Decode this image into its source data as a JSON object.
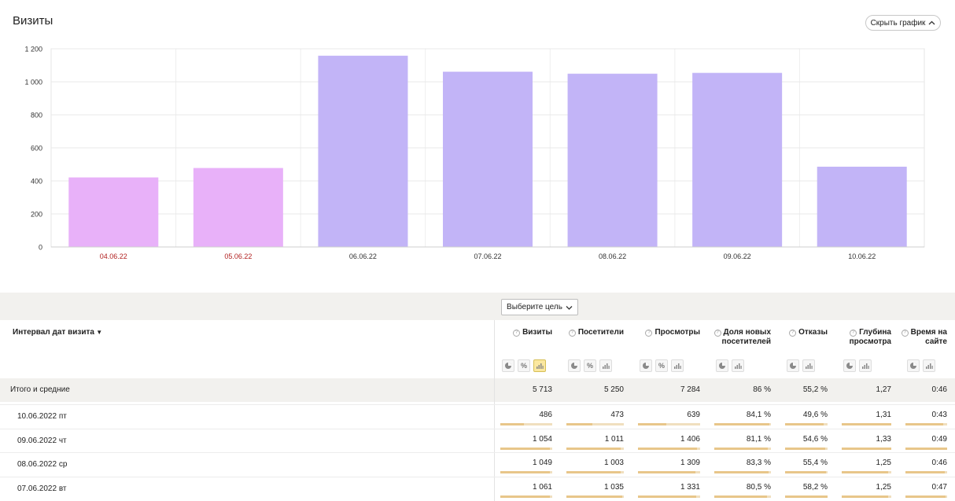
{
  "title": "Визиты",
  "hide_chart_label": "Скрыть график",
  "goal_select_label": "Выберите цель",
  "chart_data": {
    "type": "bar",
    "categories": [
      "04.06.22",
      "05.06.22",
      "06.06.22",
      "07.06.22",
      "08.06.22",
      "09.06.22",
      "10.06.22"
    ],
    "values": [
      421,
      478,
      1158,
      1061,
      1049,
      1054,
      486
    ],
    "weekend": [
      true,
      true,
      false,
      false,
      false,
      false,
      false
    ],
    "yticks": [
      "0",
      "200",
      "400",
      "600",
      "800",
      "1 000",
      "1 200"
    ],
    "ylim": [
      0,
      1200
    ],
    "colors": {
      "weekday": "#c2b4f7",
      "weekend": "#e8b1f9",
      "weekend_label": "#b22222"
    },
    "grid": true
  },
  "table": {
    "dim_header": "Интервал дат визита",
    "columns": [
      {
        "name": "visits",
        "label": "Визиты",
        "icons": [
          "pie",
          "percent",
          "bars"
        ],
        "active": "bars"
      },
      {
        "name": "visitors",
        "label": "Посетители",
        "icons": [
          "pie",
          "percent",
          "bars"
        ]
      },
      {
        "name": "pageviews",
        "label": "Просмотры",
        "icons": [
          "pie",
          "percent",
          "bars"
        ]
      },
      {
        "name": "new-visitors-share",
        "label": "Доля новых посетителей",
        "icons": [
          "pie",
          "bars"
        ]
      },
      {
        "name": "bounces",
        "label": "Отказы",
        "icons": [
          "pie",
          "bars"
        ]
      },
      {
        "name": "depth",
        "label": "Глубина просмотра",
        "icons": [
          "pie",
          "bars"
        ]
      },
      {
        "name": "time-on-site",
        "label": "Время на сайте",
        "icons": [
          "pie",
          "bars"
        ]
      }
    ],
    "total": {
      "label": "Итого и средние",
      "values": [
        "5 713",
        "5 250",
        "7 284",
        "86 %",
        "55,2 %",
        "1,27",
        "0:46"
      ]
    },
    "rows": [
      {
        "label": "10.06.2022 пт",
        "values": [
          "486",
          "473",
          "639",
          "84,1 %",
          "49,6 %",
          "1,31",
          "0:43"
        ],
        "fill": [
          0.45,
          0.45,
          0.45,
          0.97,
          0.9,
          1.0,
          0.9
        ]
      },
      {
        "label": "09.06.2022 чт",
        "values": [
          "1 054",
          "1 011",
          "1 406",
          "81,1 %",
          "54,6 %",
          "1,33",
          "0:49"
        ],
        "fill": [
          0.95,
          0.95,
          0.95,
          0.94,
          0.95,
          1.0,
          1.0
        ]
      },
      {
        "label": "08.06.2022 ср",
        "values": [
          "1 049",
          "1 003",
          "1 309",
          "83,3 %",
          "55,4 %",
          "1,25",
          "0:46"
        ],
        "fill": [
          0.95,
          0.95,
          0.93,
          0.96,
          0.96,
          0.94,
          0.94
        ]
      },
      {
        "label": "07.06.2022 вт",
        "values": [
          "1 061",
          "1 035",
          "1 331",
          "80,5 %",
          "58,2 %",
          "1,25",
          "0:47"
        ],
        "fill": [
          0.96,
          0.97,
          0.94,
          0.93,
          1.0,
          0.94,
          0.96
        ]
      }
    ]
  }
}
